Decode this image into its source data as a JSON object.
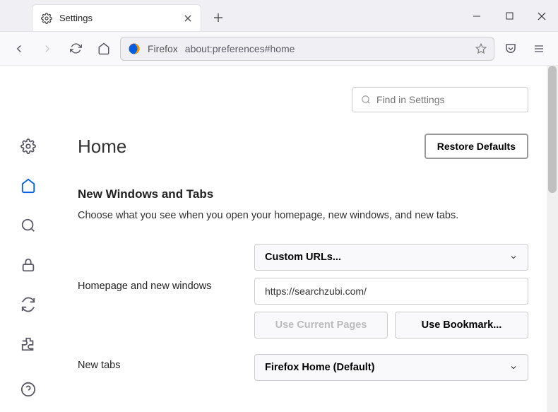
{
  "tab": {
    "title": "Settings"
  },
  "urlbar": {
    "identity": "Firefox",
    "url": "about:preferences#home"
  },
  "search": {
    "placeholder": "Find in Settings"
  },
  "page": {
    "title": "Home",
    "restore": "Restore Defaults",
    "section_title": "New Windows and Tabs",
    "section_desc": "Choose what you see when you open your homepage, new windows, and new tabs."
  },
  "form": {
    "homepage_label": "Homepage and new windows",
    "homepage_dropdown": "Custom URLs...",
    "homepage_value": "https://searchzubi.com/",
    "use_current": "Use Current Pages",
    "use_bookmark": "Use Bookmark...",
    "newtabs_label": "New tabs",
    "newtabs_dropdown": "Firefox Home (Default)"
  }
}
